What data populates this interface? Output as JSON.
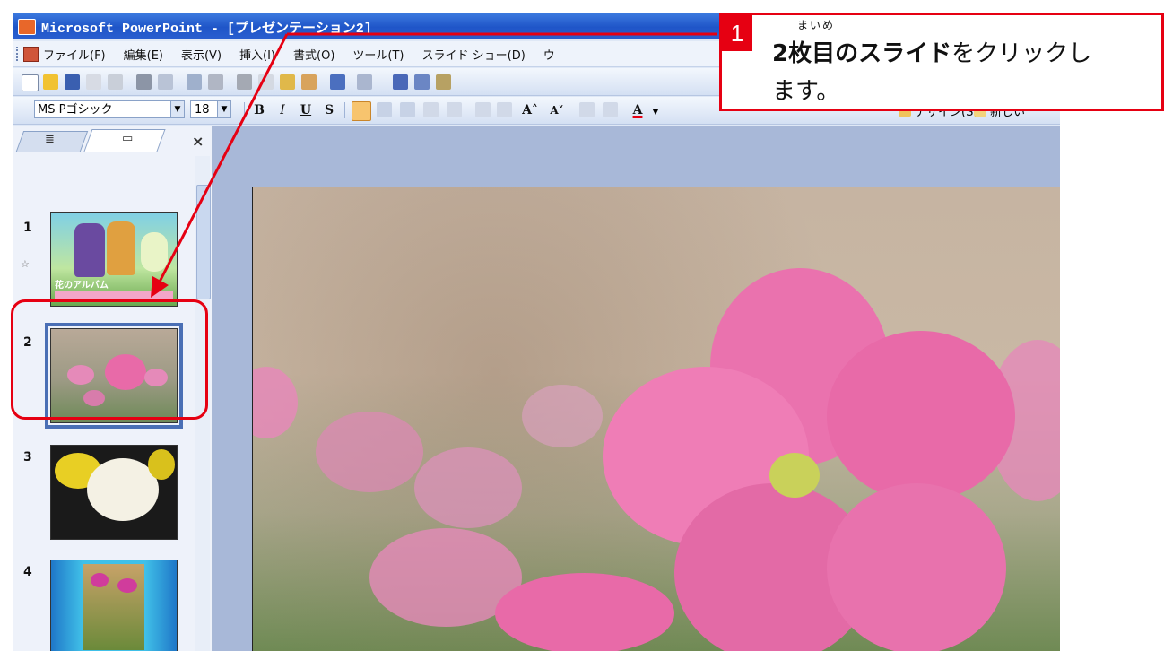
{
  "window": {
    "title": "Microsoft PowerPoint - [プレゼンテーション2]"
  },
  "menu": {
    "items": [
      "ファイル(F)",
      "編集(E)",
      "表示(V)",
      "挿入(I)",
      "書式(O)",
      "ツール(T)",
      "スライド ショー(D)",
      "ウ"
    ]
  },
  "format": {
    "font": "MS Pゴシック",
    "size": "18",
    "bold": "B",
    "italic": "I",
    "underline": "U",
    "shadow": "S",
    "grow_font": "A˄",
    "shrink_font": "A˅",
    "font_color": "A",
    "design_label": "デザイン(S)",
    "new_slide_label": "新しい"
  },
  "slides_pane": {
    "slides": [
      {
        "number": "1",
        "caption": "花のアルバム"
      },
      {
        "number": "2"
      },
      {
        "number": "3"
      },
      {
        "number": "4"
      }
    ],
    "selected": "2"
  },
  "callout": {
    "step": "1",
    "ruby": "まいめ",
    "line1_bold": "2枚目のスライド",
    "line1_rest": "をクリックし",
    "line2": "ます。"
  },
  "colors": {
    "accent_red": "#e60012",
    "title_blue": "#1f55c8",
    "selection_blue": "#4a6fb5",
    "flower_pink": "#e86aa8"
  }
}
